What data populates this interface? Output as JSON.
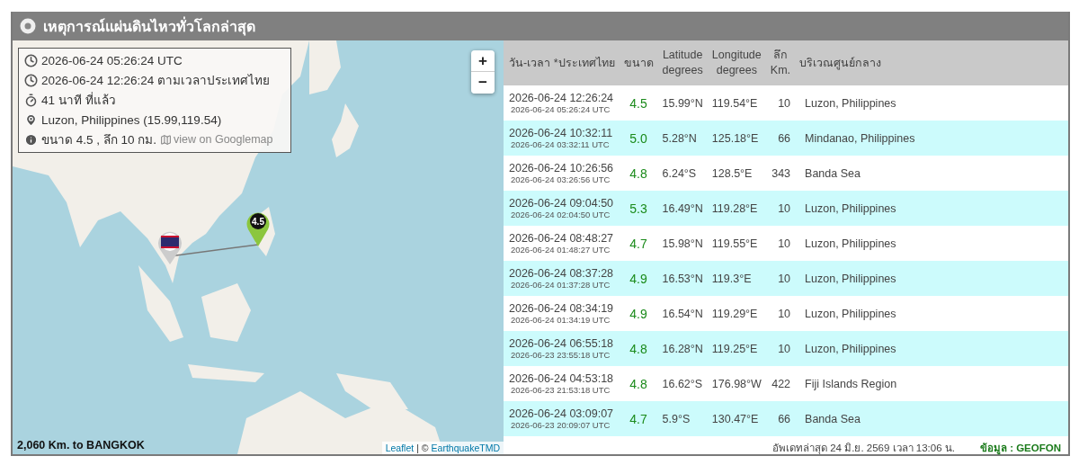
{
  "title": "เหตุการณ์แผ่นดินไหวทั่วโลกล่าสุด",
  "map": {
    "info": [
      {
        "kind": "clock",
        "text": "2026-06-24 05:26:24 UTC"
      },
      {
        "kind": "clock",
        "text": "2026-06-24 12:26:24 ตามเวลาประเทศไทย"
      },
      {
        "kind": "timer",
        "text": "41 นาที ที่แล้ว"
      },
      {
        "kind": "pin",
        "text": "Luzon, Philippines (15.99,119.54)"
      },
      {
        "kind": "info",
        "text": "ขนาด 4.5 , ลึก 10 กม.",
        "link": "view on Googlemap"
      }
    ],
    "zoom_in": "+",
    "zoom_out": "−",
    "marker_label": "4.5",
    "distance": "2,060 Km. to BANGKOK",
    "attribution": {
      "leaflet": "Leaflet",
      "separator": "| ©",
      "source": "EarthquakeTMD"
    }
  },
  "table": {
    "columns": [
      [
        "วัน-เวลา *ประเทศไทย"
      ],
      [
        "ขนาด"
      ],
      [
        "Latitude",
        "degrees"
      ],
      [
        "Longitude",
        "degrees"
      ],
      [
        "ลึก",
        "Km."
      ],
      [
        "บริเวณศูนย์กลาง"
      ]
    ],
    "rows": [
      {
        "local": "2026-06-24 12:26:24",
        "utc": "2026-06-24 05:26:24 UTC",
        "mag": "4.5",
        "lat": "15.99°N",
        "lon": "119.54°E",
        "depth": "10",
        "region": "Luzon, Philippines"
      },
      {
        "local": "2026-06-24 10:32:11",
        "utc": "2026-06-24 03:32:11 UTC",
        "mag": "5.0",
        "lat": "5.28°N",
        "lon": "125.18°E",
        "depth": "66",
        "region": "Mindanao, Philippines"
      },
      {
        "local": "2026-06-24 10:26:56",
        "utc": "2026-06-24 03:26:56 UTC",
        "mag": "4.8",
        "lat": "6.24°S",
        "lon": "128.5°E",
        "depth": "343",
        "region": "Banda Sea"
      },
      {
        "local": "2026-06-24 09:04:50",
        "utc": "2026-06-24 02:04:50 UTC",
        "mag": "5.3",
        "lat": "16.49°N",
        "lon": "119.28°E",
        "depth": "10",
        "region": "Luzon, Philippines"
      },
      {
        "local": "2026-06-24 08:48:27",
        "utc": "2026-06-24 01:48:27 UTC",
        "mag": "4.7",
        "lat": "15.98°N",
        "lon": "119.55°E",
        "depth": "10",
        "region": "Luzon, Philippines"
      },
      {
        "local": "2026-06-24 08:37:28",
        "utc": "2026-06-24 01:37:28 UTC",
        "mag": "4.9",
        "lat": "16.53°N",
        "lon": "119.3°E",
        "depth": "10",
        "region": "Luzon, Philippines"
      },
      {
        "local": "2026-06-24 08:34:19",
        "utc": "2026-06-24 01:34:19 UTC",
        "mag": "4.9",
        "lat": "16.54°N",
        "lon": "119.29°E",
        "depth": "10",
        "region": "Luzon, Philippines"
      },
      {
        "local": "2026-06-24 06:55:18",
        "utc": "2026-06-23 23:55:18 UTC",
        "mag": "4.8",
        "lat": "16.28°N",
        "lon": "119.25°E",
        "depth": "10",
        "region": "Luzon, Philippines"
      },
      {
        "local": "2026-06-24 04:53:18",
        "utc": "2026-06-23 21:53:18 UTC",
        "mag": "4.8",
        "lat": "16.62°S",
        "lon": "176.98°W",
        "depth": "422",
        "region": "Fiji Islands Region"
      },
      {
        "local": "2026-06-24 03:09:07",
        "utc": "2026-06-23 20:09:07 UTC",
        "mag": "4.7",
        "lat": "5.9°S",
        "lon": "130.47°E",
        "depth": "66",
        "region": "Banda Sea"
      }
    ]
  },
  "footer": {
    "updated": "อัพเดทล่าสุด 24 มิ.ย. 2569 เวลา 13:06 น.",
    "source": "ข้อมูล : GEOFON"
  }
}
